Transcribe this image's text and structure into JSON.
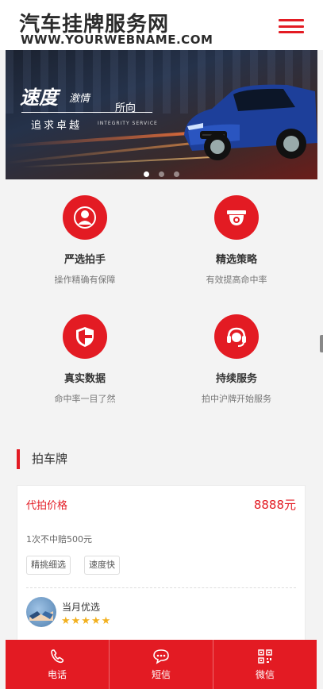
{
  "header": {
    "logo_cn": "汽车挂牌服务网",
    "logo_en": "WWW.YOURWEBNAME.COM",
    "menu_icon": "hamburger-icon"
  },
  "banner": {
    "title": "速度",
    "subtitle_a": "激情",
    "subtitle_b": "所向",
    "slogan": "追求卓越",
    "slogan_en": "INTEGRITY SERVICE",
    "slides": 3,
    "active_slide": 1
  },
  "features": [
    {
      "title": "严选拍手",
      "desc": "操作精确有保障",
      "icon": "person-icon"
    },
    {
      "title": "精选策略",
      "desc": "有效提高命中率",
      "icon": "camera-icon"
    },
    {
      "title": "真实数据",
      "desc": "命中率一目了然",
      "icon": "shield-icon"
    },
    {
      "title": "持续服务",
      "desc": "拍中沪牌开始服务",
      "icon": "headset-icon"
    }
  ],
  "section": {
    "title": "拍车牌"
  },
  "card": {
    "title": "代拍价格",
    "price": "8888元",
    "desc": "1次不中赔500元",
    "tags": [
      "精挑细选",
      "速度快"
    ],
    "reviewer_name": "当月优选",
    "rating": 5,
    "stars_text": "★★★★★"
  },
  "bottom_bar": [
    {
      "label": "电话",
      "icon": "phone-icon"
    },
    {
      "label": "短信",
      "icon": "chat-icon"
    },
    {
      "label": "微信",
      "icon": "qrcode-icon"
    }
  ],
  "colors": {
    "accent": "#e31b23",
    "star": "#f2b01e"
  }
}
